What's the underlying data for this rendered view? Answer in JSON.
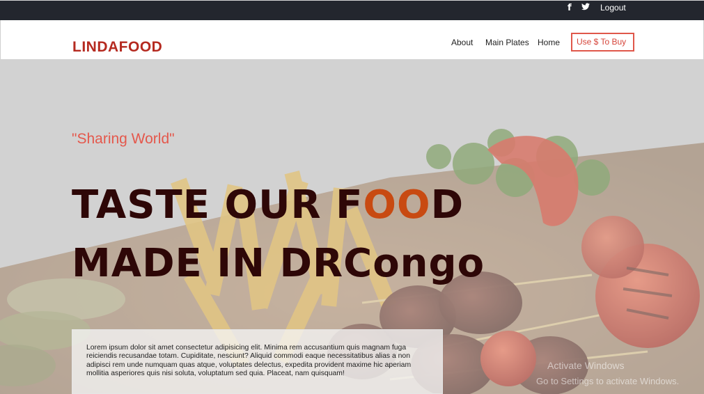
{
  "topbar": {
    "facebook_icon": "f",
    "twitter_icon": "🐦",
    "logout_label": "Logout"
  },
  "navbar": {
    "brand": "LINDAFOOD",
    "links": [
      "About",
      "Main Plates",
      "Home"
    ],
    "buy_button": "Use $ To Buy"
  },
  "hero": {
    "tagline": "\"Sharing World\"",
    "headline_line1_a": "TASTE OUR F",
    "headline_line1_b": "OO",
    "headline_line1_c": "D",
    "headline_line2": "MADE IN DRCongo",
    "body": "Lorem ipsum dolor sit amet consectetur adipisicing elit. Minima rem accusantium quis magnam fuga reiciendis recusandae totam. Cupiditate, nesciunt? Aliquid commodi eaque necessitatibus alias a non adipisci rem unde numquam quas atque, voluptates delectus, expedita provident maxime hic aperiam mollitia asperiores quis nisi soluta, voluptatum sed quia. Placeat, nam quisquam!"
  },
  "watermark": {
    "line1": "Activate Windows",
    "line2": "Go to Settings to activate Windows."
  },
  "colors": {
    "brand": "#b52a20",
    "accent": "#e0574a",
    "topbar_bg": "#23262e",
    "headline": "#2e0707"
  }
}
